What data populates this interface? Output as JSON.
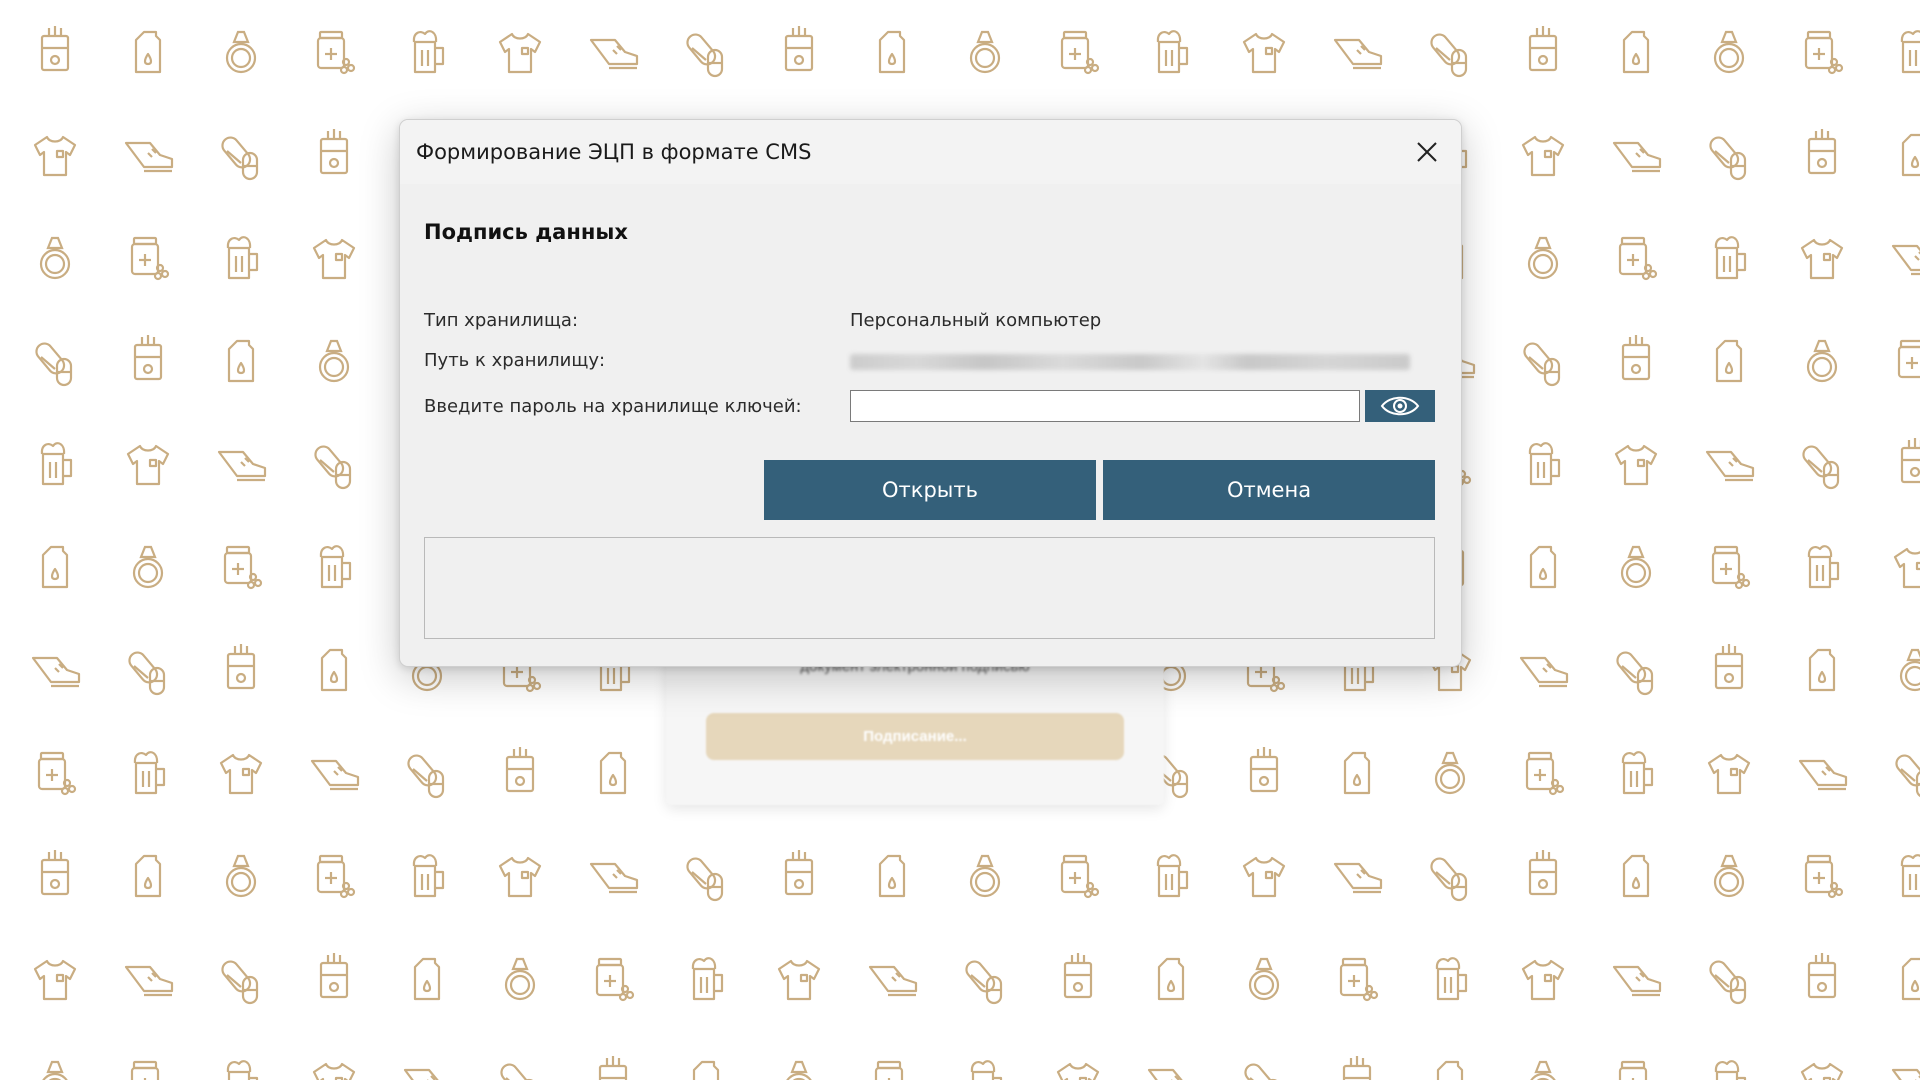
{
  "background": {
    "pattern_icons": [
      "cigarette-pack-icon",
      "canister-icon",
      "ring-icon",
      "pills-jar-icon",
      "beer-mug-icon",
      "tshirt-icon",
      "sneaker-icon",
      "capsule-icon"
    ],
    "icon_color": "#c9ad82",
    "underlying_page": {
      "caption": "документ электронной подписью",
      "button_label": "Подписание..."
    }
  },
  "dialog": {
    "title": "Формирование ЭЦП в формате CMS",
    "section_title": "Подпись данных",
    "fields": {
      "storage_type_label": "Тип хранилища:",
      "storage_type_value": "Персональный компьютер",
      "storage_path_label": "Путь к хранилищу:",
      "password_label": "Введите пароль на хранилище ключей:",
      "password_value": ""
    },
    "buttons": {
      "open_label": "Открыть",
      "cancel_label": "Отмена"
    },
    "accent_color": "#34607a"
  }
}
